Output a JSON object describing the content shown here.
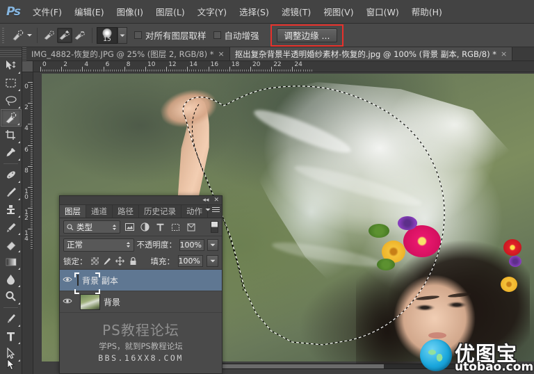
{
  "app": {
    "logo": "Ps"
  },
  "menubar": {
    "items": [
      {
        "label": "文件(F)",
        "name": "menu-file"
      },
      {
        "label": "编辑(E)",
        "name": "menu-edit"
      },
      {
        "label": "图像(I)",
        "name": "menu-image"
      },
      {
        "label": "图层(L)",
        "name": "menu-layer"
      },
      {
        "label": "文字(Y)",
        "name": "menu-type"
      },
      {
        "label": "选择(S)",
        "name": "menu-select"
      },
      {
        "label": "滤镜(T)",
        "name": "menu-filter"
      },
      {
        "label": "视图(V)",
        "name": "menu-view"
      },
      {
        "label": "窗口(W)",
        "name": "menu-window"
      },
      {
        "label": "帮助(H)",
        "name": "menu-help"
      }
    ]
  },
  "options_bar": {
    "tool_icon": "quick-selection-tool-icon",
    "mode_new_label": "new-selection",
    "mode_add_label": "add-to-selection",
    "mode_subtract_label": "subtract-from-selection",
    "brush_size": "15",
    "sample_all_layers": {
      "label": "对所有图层取样",
      "checked": false
    },
    "auto_enhance": {
      "label": "自动增强",
      "checked": false
    },
    "refine_edge": {
      "label": "调整边缘 ...",
      "highlight_color": "#e8312b"
    }
  },
  "tabs": [
    {
      "label": "IMG_4882-恢复的.JPG @ 25% (图层 2, RGB/8) *",
      "close": "×",
      "active": false
    },
    {
      "label": "抠出复杂背景半透明婚纱素材-恢复的.jpg @ 100% (背景 副本, RGB/8) *",
      "close": "×",
      "active": true
    }
  ],
  "rulers": {
    "horizontal_labels": [
      "0",
      "2",
      "4",
      "6",
      "8",
      "10",
      "12",
      "14",
      "16",
      "18",
      "20",
      "22",
      "24"
    ],
    "vertical_labels": [
      "0",
      "2",
      "4",
      "6",
      "8",
      "10",
      "12",
      "14"
    ],
    "unit": "cm"
  },
  "toolbox": {
    "tools": [
      {
        "name": "move-tool-icon",
        "glyph": "✥",
        "selected": false
      },
      {
        "name": "rectangular-marquee-tool-icon",
        "glyph": "▭",
        "selected": false
      },
      {
        "name": "lasso-tool-icon",
        "glyph": "◯",
        "selected": false
      },
      {
        "name": "quick-selection-tool-icon",
        "glyph": "✎",
        "selected": true
      },
      {
        "name": "crop-tool-icon",
        "glyph": "⌗",
        "selected": false
      },
      {
        "name": "eyedropper-tool-icon",
        "glyph": "✒",
        "selected": false
      },
      {
        "name": "spot-healing-brush-tool-icon",
        "glyph": "✧",
        "selected": false
      },
      {
        "name": "brush-tool-icon",
        "glyph": "🖌",
        "selected": false
      },
      {
        "name": "clone-stamp-tool-icon",
        "glyph": "⚲",
        "selected": false
      },
      {
        "name": "history-brush-tool-icon",
        "glyph": "↺",
        "selected": false
      },
      {
        "name": "eraser-tool-icon",
        "glyph": "▱",
        "selected": false
      },
      {
        "name": "gradient-tool-icon",
        "glyph": "▤",
        "selected": false
      },
      {
        "name": "blur-tool-icon",
        "glyph": "💧",
        "selected": false
      },
      {
        "name": "dodge-tool-icon",
        "glyph": "🔍",
        "selected": false
      },
      {
        "name": "pen-tool-icon",
        "glyph": "✐",
        "selected": false
      },
      {
        "name": "horizontal-type-tool-icon",
        "glyph": "T",
        "selected": false
      },
      {
        "name": "path-selection-tool-icon",
        "glyph": "➤",
        "selected": false
      }
    ]
  },
  "layers_panel": {
    "collapse_icon": "◂◂",
    "close_icon": "✕",
    "tabs": [
      {
        "label": "图层",
        "active": true
      },
      {
        "label": "通道",
        "active": false
      },
      {
        "label": "路径",
        "active": false
      },
      {
        "label": "历史记录",
        "active": false
      },
      {
        "label": "动作",
        "active": false
      }
    ],
    "filter": {
      "search_icon": "search-icon",
      "type_label": "类型",
      "icons": [
        "pixel-layer-filter-icon",
        "adjustment-layer-filter-icon",
        "type-layer-filter-icon",
        "shape-layer-filter-icon",
        "smart-object-filter-icon"
      ],
      "toggle": "filter-enable-toggle"
    },
    "blend_mode": "正常",
    "opacity_label": "不透明度：",
    "opacity_value": "100%",
    "lock_label": "锁定：",
    "fill_label": "填充：",
    "fill_value": "100%",
    "lock_icons": [
      "lock-transparent-pixels-icon",
      "lock-image-pixels-icon",
      "lock-position-icon",
      "lock-all-icon"
    ],
    "layers": [
      {
        "name": "背景 副本",
        "visible": true,
        "selected": true
      },
      {
        "name": "背景",
        "visible": true,
        "selected": false
      }
    ]
  },
  "watermark": {
    "line1": "PS教程论坛",
    "line2": "学PS，就到PS教程论坛",
    "line3": "BBS.16XX8.COM"
  },
  "site_logo": {
    "cn": "优图宝",
    "en": "utobao.com",
    "accent": "#1aa7dd"
  },
  "theme": {
    "menubar_bg": "#434343",
    "optionsbar_bg": "#494949",
    "panel_bg": "#4a4a4a",
    "canvas_bg": "#3f3f3f",
    "selected_layer_bg": "#5f7792",
    "highlight_red": "#e8312b"
  }
}
